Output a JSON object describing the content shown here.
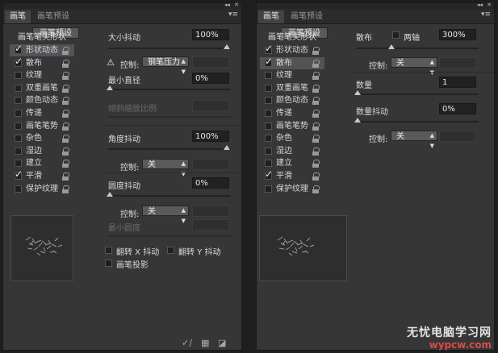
{
  "tabs": [
    "画笔",
    "画笔预设"
  ],
  "preset_button": "画笔预设",
  "list_header": "画笔笔尖形状",
  "list_items": [
    {
      "label": "形状动态",
      "checked": true
    },
    {
      "label": "散布",
      "checked": true
    },
    {
      "label": "纹理",
      "checked": false
    },
    {
      "label": "双重画笔",
      "checked": false
    },
    {
      "label": "颜色动态",
      "checked": false
    },
    {
      "label": "传递",
      "checked": false
    },
    {
      "label": "画笔笔势",
      "checked": false
    },
    {
      "label": "杂色",
      "checked": false
    },
    {
      "label": "湿边",
      "checked": false
    },
    {
      "label": "建立",
      "checked": false
    },
    {
      "label": "平滑",
      "checked": true
    },
    {
      "label": "保护纹理",
      "checked": false
    }
  ],
  "left_panel": {
    "selected_index": 0,
    "size_jitter_label": "大小抖动",
    "size_jitter_value": "100%",
    "control_label": "控制:",
    "control1_value": "钢笔压力",
    "min_diameter_label": "最小直径",
    "min_diameter_value": "0%",
    "tilt_scale_label": "倾斜缩放比例",
    "angle_jitter_label": "角度抖动",
    "angle_jitter_value": "100%",
    "control2_value": "关",
    "roundness_jitter_label": "圆度抖动",
    "roundness_jitter_value": "0%",
    "control3_value": "关",
    "min_roundness_label": "最小圆度",
    "flip_x_label": "翻转 X 抖动",
    "flip_y_label": "翻转 Y 抖动",
    "brush_projection_label": "画笔投影"
  },
  "right_panel": {
    "selected_index": 1,
    "scatter_label": "散布",
    "both_axes_label": "两轴",
    "scatter_value": "300%",
    "control_label": "控制:",
    "control1_value": "关",
    "count_label": "数量",
    "count_value": "1",
    "count_jitter_label": "数量抖动",
    "count_jitter_value": "0%",
    "control2_value": "关"
  },
  "watermark": {
    "line1": "无忧电脑学习网",
    "line2": "wypcw.com"
  }
}
